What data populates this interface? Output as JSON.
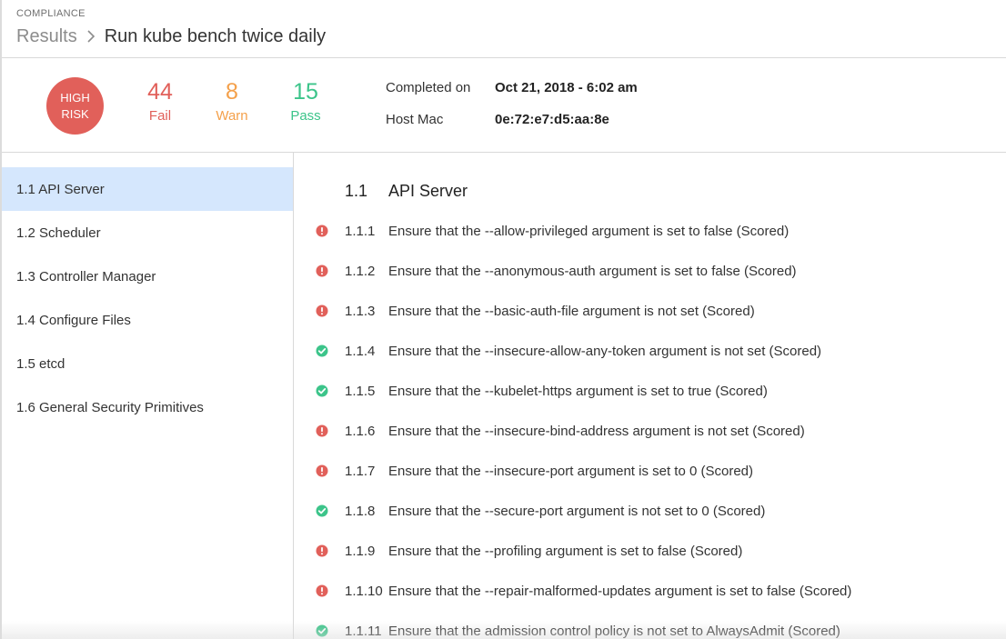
{
  "header": {
    "section_label": "COMPLIANCE",
    "breadcrumb_root": "Results",
    "breadcrumb_current": "Run kube bench twice daily"
  },
  "summary": {
    "risk_line1": "HIGH",
    "risk_line2": "RISK",
    "fail_count": "44",
    "fail_label": "Fail",
    "warn_count": "8",
    "warn_label": "Warn",
    "pass_count": "15",
    "pass_label": "Pass",
    "completed_label": "Completed on",
    "completed_value": "Oct 21, 2018 - 6:02 am",
    "host_label": "Host Mac",
    "host_value": "0e:72:e7:d5:aa:8e"
  },
  "colors": {
    "fail": "#e1605a",
    "warn": "#f4a04a",
    "pass": "#3cc48a",
    "active_nav": "#d5e7fd"
  },
  "sidebar": {
    "items": [
      {
        "label": "1.1 API Server",
        "active": true
      },
      {
        "label": "1.2 Scheduler",
        "active": false
      },
      {
        "label": "1.3 Controller Manager",
        "active": false
      },
      {
        "label": "1.4 Configure Files",
        "active": false
      },
      {
        "label": "1.5 etcd",
        "active": false
      },
      {
        "label": "1.6 General Security Primitives",
        "active": false
      }
    ]
  },
  "section": {
    "number": "1.1",
    "title": "API Server",
    "checks": [
      {
        "number": "1.1.1",
        "text": "Ensure that the --allow-privileged argument is set to false (Scored)",
        "status": "fail",
        "icon": "fail-icon"
      },
      {
        "number": "1.1.2",
        "text": "Ensure that the --anonymous-auth argument is set to false (Scored)",
        "status": "fail",
        "icon": "fail-icon"
      },
      {
        "number": "1.1.3",
        "text": "Ensure that the --basic-auth-file argument is not set (Scored)",
        "status": "fail",
        "icon": "fail-icon"
      },
      {
        "number": "1.1.4",
        "text": "Ensure that the --insecure-allow-any-token argument is not set (Scored)",
        "status": "pass",
        "icon": "pass-icon"
      },
      {
        "number": "1.1.5",
        "text": "Ensure that the --kubelet-https argument is set to true (Scored)",
        "status": "pass",
        "icon": "pass-icon"
      },
      {
        "number": "1.1.6",
        "text": "Ensure that the --insecure-bind-address argument is not set (Scored)",
        "status": "fail",
        "icon": "fail-icon"
      },
      {
        "number": "1.1.7",
        "text": "Ensure that the --insecure-port argument is set to 0 (Scored)",
        "status": "fail",
        "icon": "fail-icon"
      },
      {
        "number": "1.1.8",
        "text": "Ensure that the --secure-port argument is not set to 0 (Scored)",
        "status": "pass",
        "icon": "pass-icon"
      },
      {
        "number": "1.1.9",
        "text": "Ensure that the --profiling argument is set to false (Scored)",
        "status": "fail",
        "icon": "fail-icon"
      },
      {
        "number": "1.1.10",
        "text": "Ensure that the --repair-malformed-updates argument is set to false (Scored)",
        "status": "fail",
        "icon": "fail-icon"
      },
      {
        "number": "1.1.11",
        "text": "Ensure that the admission control policy is not set to AlwaysAdmit (Scored)",
        "status": "pass",
        "icon": "pass-icon"
      }
    ]
  }
}
